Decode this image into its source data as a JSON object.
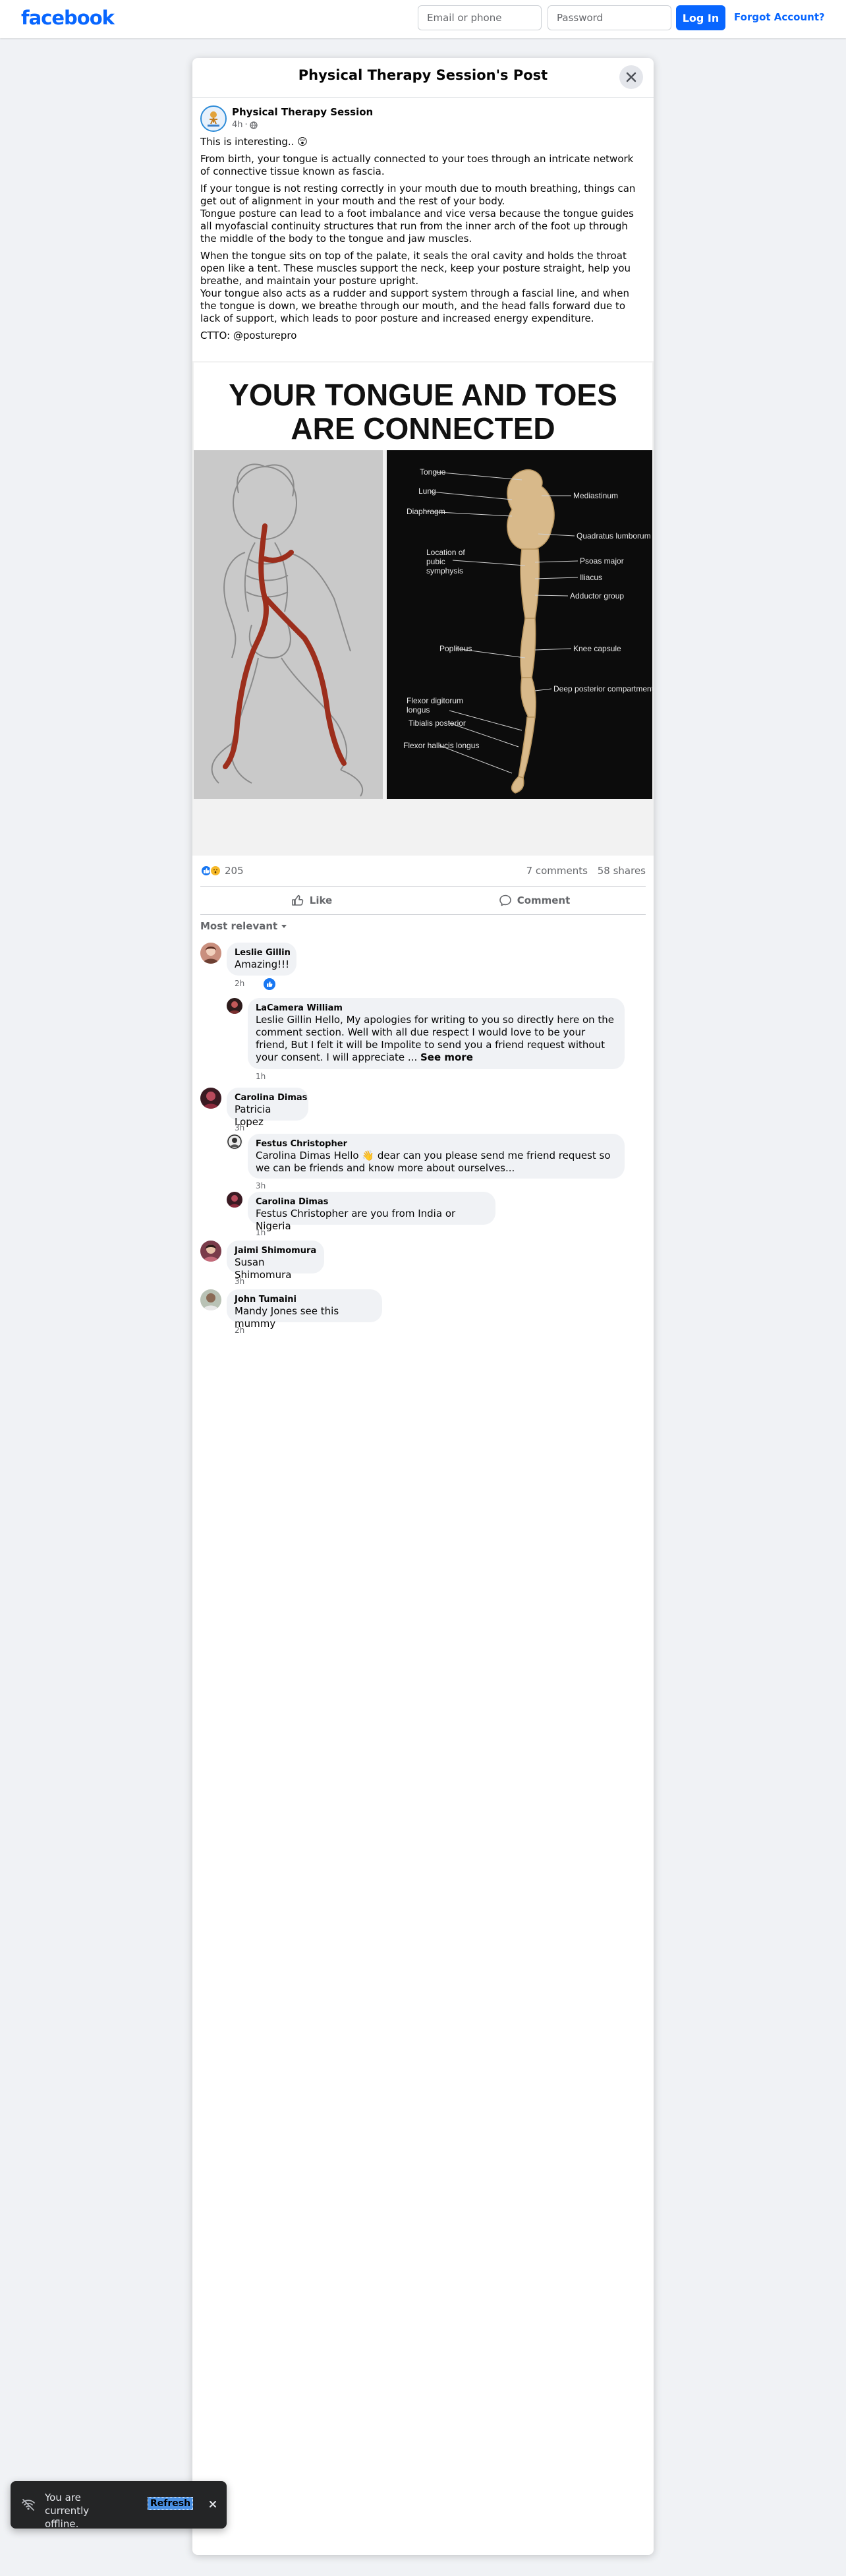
{
  "header": {
    "logo": "facebook",
    "email_placeholder": "Email or phone",
    "password_placeholder": "Password",
    "login_label": "Log In",
    "forgot_label": "Forgot Account?"
  },
  "dialog": {
    "title": "Physical Therapy Session's Post"
  },
  "post": {
    "page_name": "Physical Therapy Session",
    "time": "4h",
    "paragraphs": [
      "This is interesting.. 😲",
      "From birth, your tongue is actually connected to your toes through an intricate network of connective tissue known as fascia.",
      "If your tongue is not resting correctly in your mouth due to mouth breathing, things can get out of alignment in your mouth and the rest of your body.",
      "Tongue posture can lead to a foot imbalance and vice versa because the tongue guides all myofascial continuity structures that run from the inner arch of the foot up through the middle of the body to the tongue and jaw muscles.",
      "When the tongue sits on top of the palate, it seals the oral cavity and holds the throat open like a tent. These muscles support the neck, keep your posture straight, help you breathe, and maintain your posture upright.",
      "Your tongue also acts as a rudder and support system through a fascial line, and when the tongue is down, we breathe through our mouth, and the head falls forward due to lack of support, which leads to poor posture and increased energy expenditure.",
      "CTTO: @posturepro"
    ],
    "image": {
      "headline_line1": "YOUR TONGUE AND TOES",
      "headline_line2": "ARE CONNECTED",
      "labels": {
        "tongue": "Tongue",
        "lung": "Lung",
        "diaphragm": "Diaphragm",
        "mediastinum": "Mediastinum",
        "quadratus": "Quadratus lumborum",
        "location1": "Location of",
        "location2": "pubic",
        "location3": "symphysis",
        "psoas": "Psoas major",
        "iliacus": "Iliacus",
        "adductor": "Adductor group",
        "popliteus": "Popliteus",
        "knee": "Knee capsule",
        "deep": "Deep posterior compartment",
        "fdl1": "Flexor digitorum",
        "fdl2": "longus",
        "tibialis": "Tibialis posterior",
        "fhl": "Flexor hallucis longus"
      }
    },
    "reaction_count": "205",
    "comments_count": "7 comments",
    "shares_count": "58 shares",
    "like_label": "Like",
    "comment_label": "Comment",
    "sort_label": "Most relevant"
  },
  "comments": [
    {
      "author": "Leslie Gillin",
      "text": "Amazing!!!",
      "time": "2h"
    },
    {
      "author": "LaCamera William",
      "text": "Leslie Gillin Hello, My apologies for writing to you so directly here on the comment section. Well with all due respect I would love to be your friend, But I felt it will be Impolite to send you a friend request without your consent. I will appreciate ...",
      "see_more": "See more",
      "time": "1h"
    },
    {
      "author": "Carolina Dimas",
      "text": "Patricia Lopez",
      "time": "3h"
    },
    {
      "author": "Festus Christopher",
      "text": "Carolina Dimas Hello 👋 dear can you please send me friend request so we can be friends and know more about ourselves...",
      "time": "3h"
    },
    {
      "author": "Carolina Dimas",
      "text": "Festus Christopher are you from India or Nigeria",
      "time": "1h"
    },
    {
      "author": "Jaimi Shimomura",
      "text": "Susan Shimomura",
      "time": "3h"
    },
    {
      "author": "John Tumaini",
      "text": "Mandy Jones see this mummy",
      "time": "2h"
    }
  ],
  "toast": {
    "message": "You are currently offline.",
    "refresh_label": "Refresh"
  },
  "colors": {
    "brand": "#0866ff",
    "toast_bg": "#242526",
    "bubble_bg": "#f0f2f5"
  }
}
